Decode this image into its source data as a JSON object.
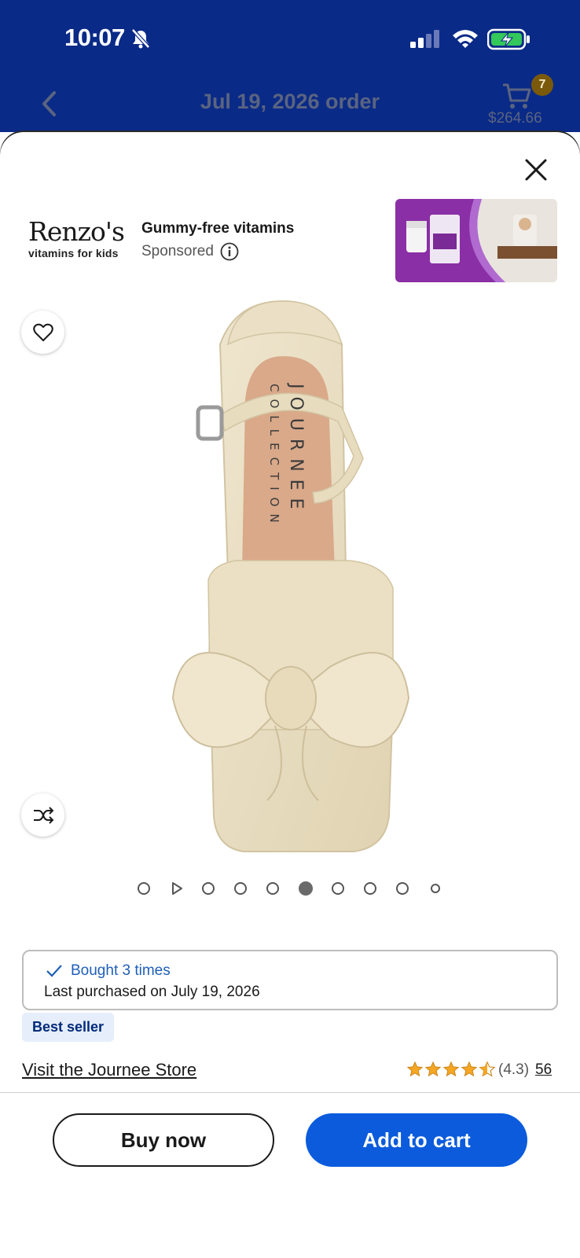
{
  "status_bar": {
    "time": "10:07"
  },
  "header": {
    "title": "Jul 19, 2026 order",
    "cart_count": "7",
    "cart_total": "$264.66"
  },
  "ad": {
    "brand_name": "Renzo's",
    "brand_tagline": "vitamins for kids",
    "headline": "Gummy-free vitamins",
    "sponsored_label": "Sponsored"
  },
  "product_image": {
    "brand_imprint_line1": "JOURNEE",
    "brand_imprint_line2": "COLLECTION"
  },
  "carousel": {
    "total_slides": 10,
    "active_index": 5
  },
  "purchase_history": {
    "bought_label": "Bought 3 times",
    "last_purchased": "Last purchased on July 19, 2026"
  },
  "product": {
    "badge": "Best seller",
    "store_link": "Visit the Journee Store",
    "rating": 4.3,
    "rating_text": "(4.3)",
    "review_count": "56"
  },
  "actions": {
    "buy_now": "Buy now",
    "add_to_cart": "Add to cart"
  },
  "colors": {
    "header_bg": "#0a2a87",
    "primary_button": "#0b5bdc",
    "badge_bg": "#e6eefb",
    "star": "#f5a623"
  }
}
